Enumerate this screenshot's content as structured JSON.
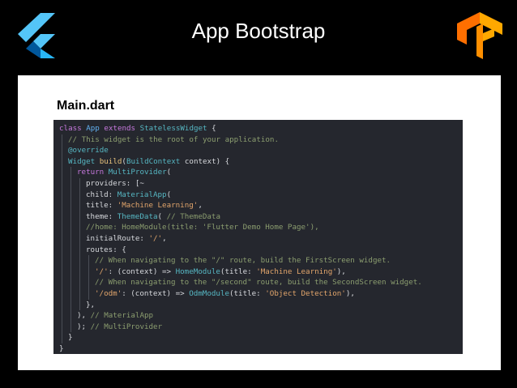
{
  "slide": {
    "title": "App Bootstrap"
  },
  "panel": {
    "file_title": "Main.dart"
  },
  "code": {
    "lines": [
      {
        "indent": 0,
        "tokens": [
          {
            "t": "class ",
            "c": "kw"
          },
          {
            "t": "App ",
            "c": "cls"
          },
          {
            "t": "extends ",
            "c": "kw"
          },
          {
            "t": "StatelessWidget",
            "c": "ty"
          },
          {
            "t": " {",
            "c": "pl"
          }
        ]
      },
      {
        "indent": 1,
        "tokens": [
          {
            "t": "// This widget is the root of your application.",
            "c": "cm"
          }
        ]
      },
      {
        "indent": 1,
        "tokens": [
          {
            "t": "@override",
            "c": "ann"
          }
        ]
      },
      {
        "indent": 1,
        "tokens": [
          {
            "t": "Widget ",
            "c": "ty"
          },
          {
            "t": "build",
            "c": "fn"
          },
          {
            "t": "(",
            "c": "pl"
          },
          {
            "t": "BuildContext",
            "c": "ty"
          },
          {
            "t": " context) {",
            "c": "pl"
          }
        ]
      },
      {
        "indent": 2,
        "tokens": [
          {
            "t": "return ",
            "c": "kw"
          },
          {
            "t": "MultiProvider",
            "c": "ty"
          },
          {
            "t": "(",
            "c": "pl"
          }
        ]
      },
      {
        "indent": 3,
        "tokens": [
          {
            "t": "providers: [~",
            "c": "pl"
          }
        ]
      },
      {
        "indent": 3,
        "tokens": [
          {
            "t": "child: ",
            "c": "pl"
          },
          {
            "t": "MaterialApp",
            "c": "ty"
          },
          {
            "t": "(",
            "c": "pl"
          }
        ]
      },
      {
        "indent": 3,
        "tokens": [
          {
            "t": "title: ",
            "c": "pl"
          },
          {
            "t": "'Machine Learning'",
            "c": "str"
          },
          {
            "t": ",",
            "c": "pl"
          }
        ]
      },
      {
        "indent": 3,
        "tokens": [
          {
            "t": "theme: ",
            "c": "pl"
          },
          {
            "t": "ThemeData",
            "c": "ty"
          },
          {
            "t": "( ",
            "c": "pl"
          },
          {
            "t": "// ThemeData",
            "c": "cm"
          }
        ]
      },
      {
        "indent": 3,
        "tokens": [
          {
            "t": "//home: HomeModule(title: 'Flutter Demo Home Page'),",
            "c": "cm"
          }
        ]
      },
      {
        "indent": 3,
        "tokens": [
          {
            "t": "initialRoute: ",
            "c": "pl"
          },
          {
            "t": "'/'",
            "c": "str"
          },
          {
            "t": ",",
            "c": "pl"
          }
        ]
      },
      {
        "indent": 3,
        "tokens": [
          {
            "t": "routes: {",
            "c": "pl"
          }
        ]
      },
      {
        "indent": 4,
        "tokens": [
          {
            "t": "// When navigating to the \"/\" route, build the FirstScreen widget.",
            "c": "cm"
          }
        ]
      },
      {
        "indent": 4,
        "tokens": [
          {
            "t": "'/'",
            "c": "str"
          },
          {
            "t": ": (context) => ",
            "c": "pl"
          },
          {
            "t": "HomeModule",
            "c": "ty"
          },
          {
            "t": "(title: ",
            "c": "pl"
          },
          {
            "t": "'Machine Learning'",
            "c": "str"
          },
          {
            "t": "),",
            "c": "pl"
          }
        ]
      },
      {
        "indent": 4,
        "tokens": [
          {
            "t": "// When navigating to the \"/second\" route, build the SecondScreen widget.",
            "c": "cm"
          }
        ]
      },
      {
        "indent": 4,
        "tokens": [
          {
            "t": "'/odm'",
            "c": "str"
          },
          {
            "t": ": (context) => ",
            "c": "pl"
          },
          {
            "t": "OdmModule",
            "c": "ty"
          },
          {
            "t": "(title: ",
            "c": "pl"
          },
          {
            "t": "'Object Detection'",
            "c": "str"
          },
          {
            "t": "),",
            "c": "pl"
          }
        ]
      },
      {
        "indent": 3,
        "tokens": [
          {
            "t": "},",
            "c": "pl"
          }
        ]
      },
      {
        "indent": 2,
        "tokens": [
          {
            "t": "), ",
            "c": "pl"
          },
          {
            "t": "// MaterialApp",
            "c": "cm"
          }
        ]
      },
      {
        "indent": 2,
        "tokens": [
          {
            "t": "); ",
            "c": "pl"
          },
          {
            "t": "// MultiProvider",
            "c": "cm"
          }
        ]
      },
      {
        "indent": 1,
        "tokens": [
          {
            "t": "}",
            "c": "pl"
          }
        ]
      },
      {
        "indent": 0,
        "tokens": [
          {
            "t": "}",
            "c": "pl"
          }
        ]
      }
    ]
  },
  "logos": {
    "left": "flutter-logo-icon",
    "right": "tensorflow-logo-icon"
  },
  "colors": {
    "background": "#000000",
    "panel": "#ffffff",
    "code_background": "#25272e",
    "flutter_light": "#54c5f8",
    "flutter_dark": "#01579b",
    "tensorflow_orange": "#ff8f00"
  }
}
